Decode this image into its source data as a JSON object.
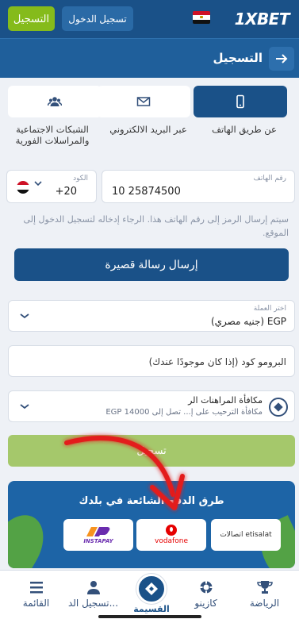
{
  "topbar": {
    "logo_prefix": "1X",
    "logo_suffix": "BET",
    "login_label": "تسجيل الدخول",
    "register_label": "التسجيل"
  },
  "header": {
    "title": "التسجيل"
  },
  "tabs": [
    {
      "label": "عن طريق الهاتف",
      "icon": "phone-icon",
      "active": true
    },
    {
      "label": "عبر البريد الالكتروني",
      "icon": "mail-icon",
      "active": false
    },
    {
      "label": "الشبكات الاجتماعية والمراسلات الفورية",
      "icon": "users-icon",
      "active": false
    }
  ],
  "phone_form": {
    "code_label": "الكود",
    "code_value": "+20",
    "phone_label": "رقم الهاتف",
    "phone_value": "10 25874500",
    "hint": "سيتم إرسال الرمز إلى رقم الهاتف هذا. الرجاء إدخاله لتسجيل الدخول إلى الموقع.",
    "sms_button": "إرسال رسالة قصيرة"
  },
  "currency": {
    "label": "اختر العملة",
    "value": "EGP (جنيه مصري)"
  },
  "promo": {
    "placeholder": "البرومو كود (إذا كان موجودًا عندك)"
  },
  "bonus": {
    "title": "مكافأة المراهنات الر",
    "subtitle": "مكافأة الترحيب على إ... تصل إلى EGP 14000"
  },
  "register_button": "تسجيل",
  "payments": {
    "title": "طرق الدفع الشائعة في بلدك",
    "logos": [
      {
        "name": "InstaPay",
        "text": "INSTAPAY"
      },
      {
        "name": "Vodafone",
        "text": "vodafone"
      },
      {
        "name": "Etisalat",
        "text": "اتصالات etisalat"
      }
    ]
  },
  "bottomnav": {
    "items": [
      {
        "label": "الرياضة",
        "icon": "trophy-icon"
      },
      {
        "label": "كازينو",
        "icon": "casino-chip-icon"
      },
      {
        "label": "القسيمة",
        "icon": "coupon-icon"
      },
      {
        "label": "تسجيل الد...",
        "icon": "user-icon"
      },
      {
        "label": "القائمة",
        "icon": "menu-icon"
      }
    ]
  },
  "colors": {
    "brand_blue": "#1a5188",
    "accent_green": "#85bb1b",
    "register_green_disabled": "#a5c86b"
  }
}
